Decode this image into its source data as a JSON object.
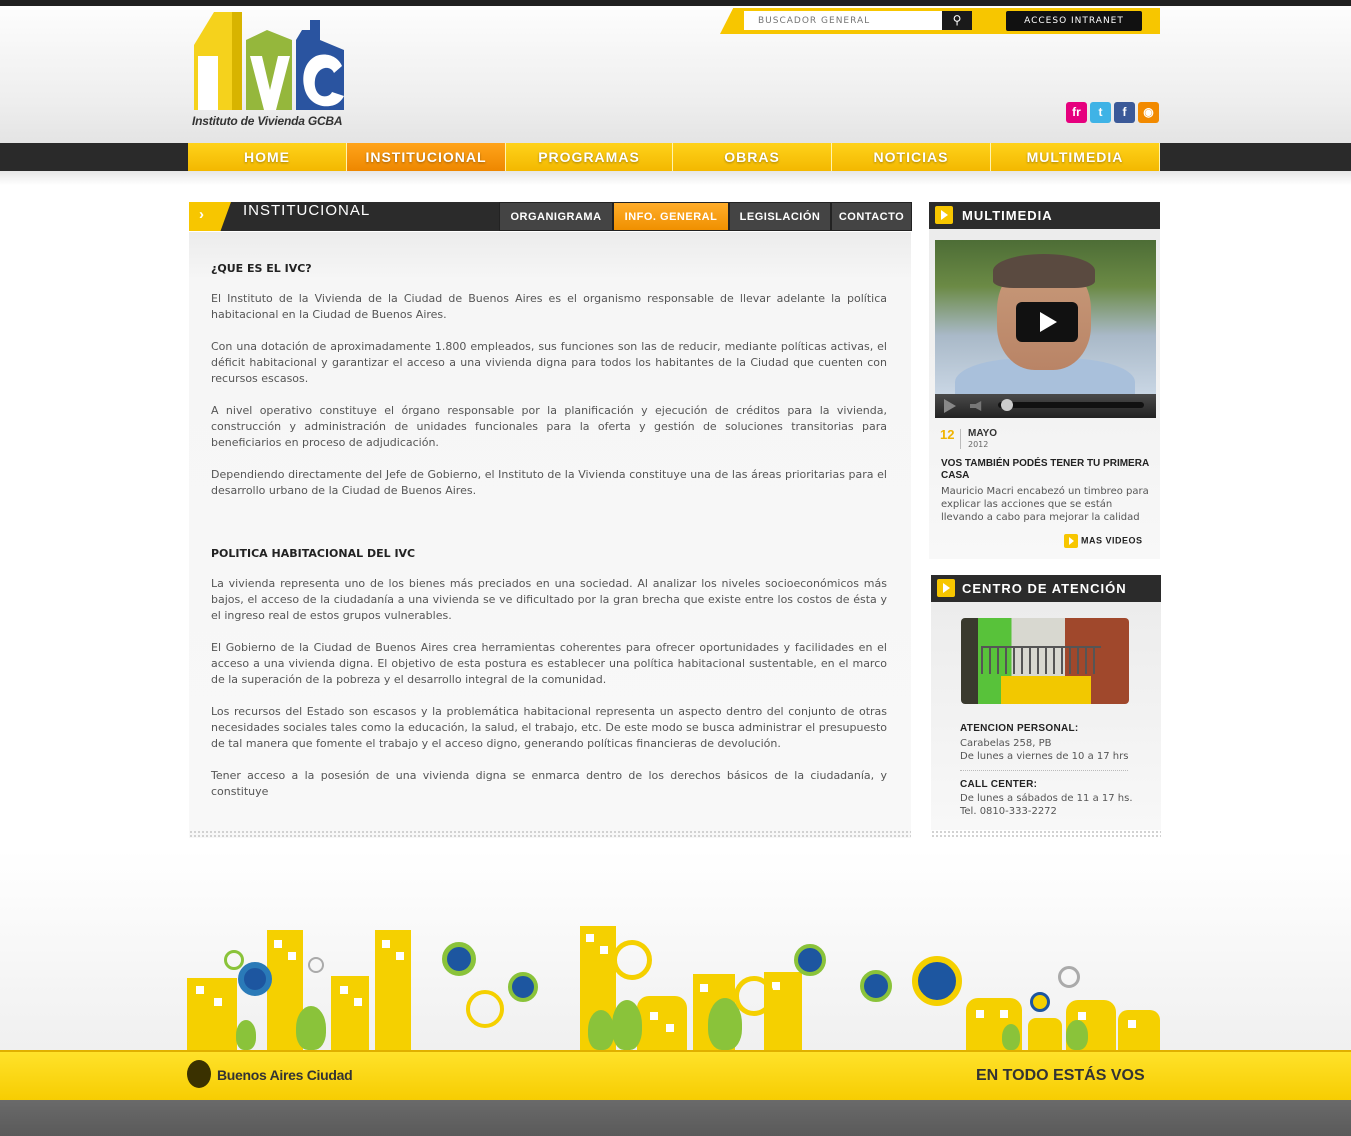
{
  "header": {
    "logo_letters": "IVC",
    "logo_subtitle": "Instituto de Vivienda GCBA",
    "search": {
      "placeholder": "BUSCADOR GENERAL",
      "button_icon": "search-icon"
    },
    "intranet_label": "ACCESO INTRANET",
    "social": [
      {
        "name": "flickr-icon",
        "glyph": "fr",
        "color": "#e6007e"
      },
      {
        "name": "twitter-icon",
        "glyph": "t",
        "color": "#3fb3e6"
      },
      {
        "name": "facebook-icon",
        "glyph": "f",
        "color": "#3b5998"
      },
      {
        "name": "rss-icon",
        "glyph": "◉",
        "color": "#f28a00"
      }
    ]
  },
  "nav": {
    "items": [
      "HOME",
      "INSTITUCIONAL",
      "PROGRAMAS",
      "OBRAS",
      "NOTICIAS",
      "MULTIMEDIA"
    ],
    "active": "INSTITUCIONAL"
  },
  "section": {
    "title": "INSTITUCIONAL",
    "subtabs": [
      "ORGANIGRAMA",
      "INFO. GENERAL",
      "LEGISLACIÓN",
      "CONTACTO"
    ],
    "active_subtab": "INFO. GENERAL"
  },
  "content": {
    "heading1": "¿QUE ES EL IVC?",
    "p1": "El Instituto de la Vivienda de la Ciudad de Buenos Aires es el organismo responsable de llevar adelante la política habitacional en la Ciudad de Buenos Aires.",
    "p2": "Con una dotación de aproximadamente 1.800 empleados, sus funciones son las de reducir, mediante políticas activas, el déficit habitacional y garantizar el acceso a una vivienda digna para todos los habitantes de la Ciudad que cuenten con recursos escasos.",
    "p3": "A nivel operativo constituye el órgano responsable por la planificación y ejecución de créditos para la vivienda, construcción y administración de unidades funcionales para la oferta y gestión de soluciones transitorias para beneficiarios en proceso de adjudicación.",
    "p4": "Dependiendo directamente del Jefe de Gobierno, el Instituto de la Vivienda constituye una de las áreas prioritarias para el desarrollo urbano de la Ciudad de Buenos Aires.",
    "heading2": "POLITICA HABITACIONAL DEL IVC",
    "p5": "La vivienda representa uno de los bienes más preciados en una sociedad. Al analizar los niveles socioeconómicos más bajos, el acceso de la ciudadanía a una vivienda se ve dificultado por la gran brecha que existe entre los costos de ésta y el ingreso real de estos grupos vulnerables.",
    "p6": "El Gobierno de la Ciudad de Buenos Aires crea herramientas coherentes para ofrecer oportunidades y facilidades en el acceso a una vivienda digna. El objetivo de esta postura es establecer una política habitacional sustentable, en el marco de la superación de la pobreza y el desarrollo integral de la comunidad.",
    "p7": "Los recursos del Estado son escasos y la problemática habitacional representa un aspecto dentro del conjunto de otras necesidades sociales tales como la educación, la salud, el trabajo, etc. De este modo se busca administrar el presupuesto de tal manera que fomente el trabajo y el acceso digno, generando políticas financieras de devolución.",
    "p8": "Tener acceso a la posesión de una vivienda digna se enmarca dentro de los derechos básicos de la ciudadanía, y constituye"
  },
  "multimedia": {
    "title": "MULTIMEDIA",
    "date_day": "12",
    "date_month": "MAYO",
    "date_year": "2012",
    "news_title": "VOS TAMBIÉN PODÉS TENER TU PRIMERA CASA",
    "news_text": "Mauricio Macri encabezó un timbreo para explicar las acciones que se están llevando a cabo para mejorar la calidad de",
    "more_label": "MAS VIDEOS"
  },
  "centro": {
    "title": "CENTRO DE ATENCIÓN",
    "personal_heading": "ATENCION PERSONAL:",
    "personal_line1": "Carabelas 258, PB",
    "personal_line2": "De lunes a viernes de 10 a 17 hrs",
    "call_heading": "CALL CENTER:",
    "call_line1": "De lunes a sábados de 11 a 17 hs.",
    "call_line2": "Tel. 0810-333-2272"
  },
  "footer": {
    "brand": "Buenos Aires Ciudad",
    "slogan": "EN TODO ESTÁS VOS"
  },
  "colors": {
    "accent_yellow": "#f7c600",
    "active_orange": "#f39200",
    "dark_bar": "#2b2b2b"
  }
}
